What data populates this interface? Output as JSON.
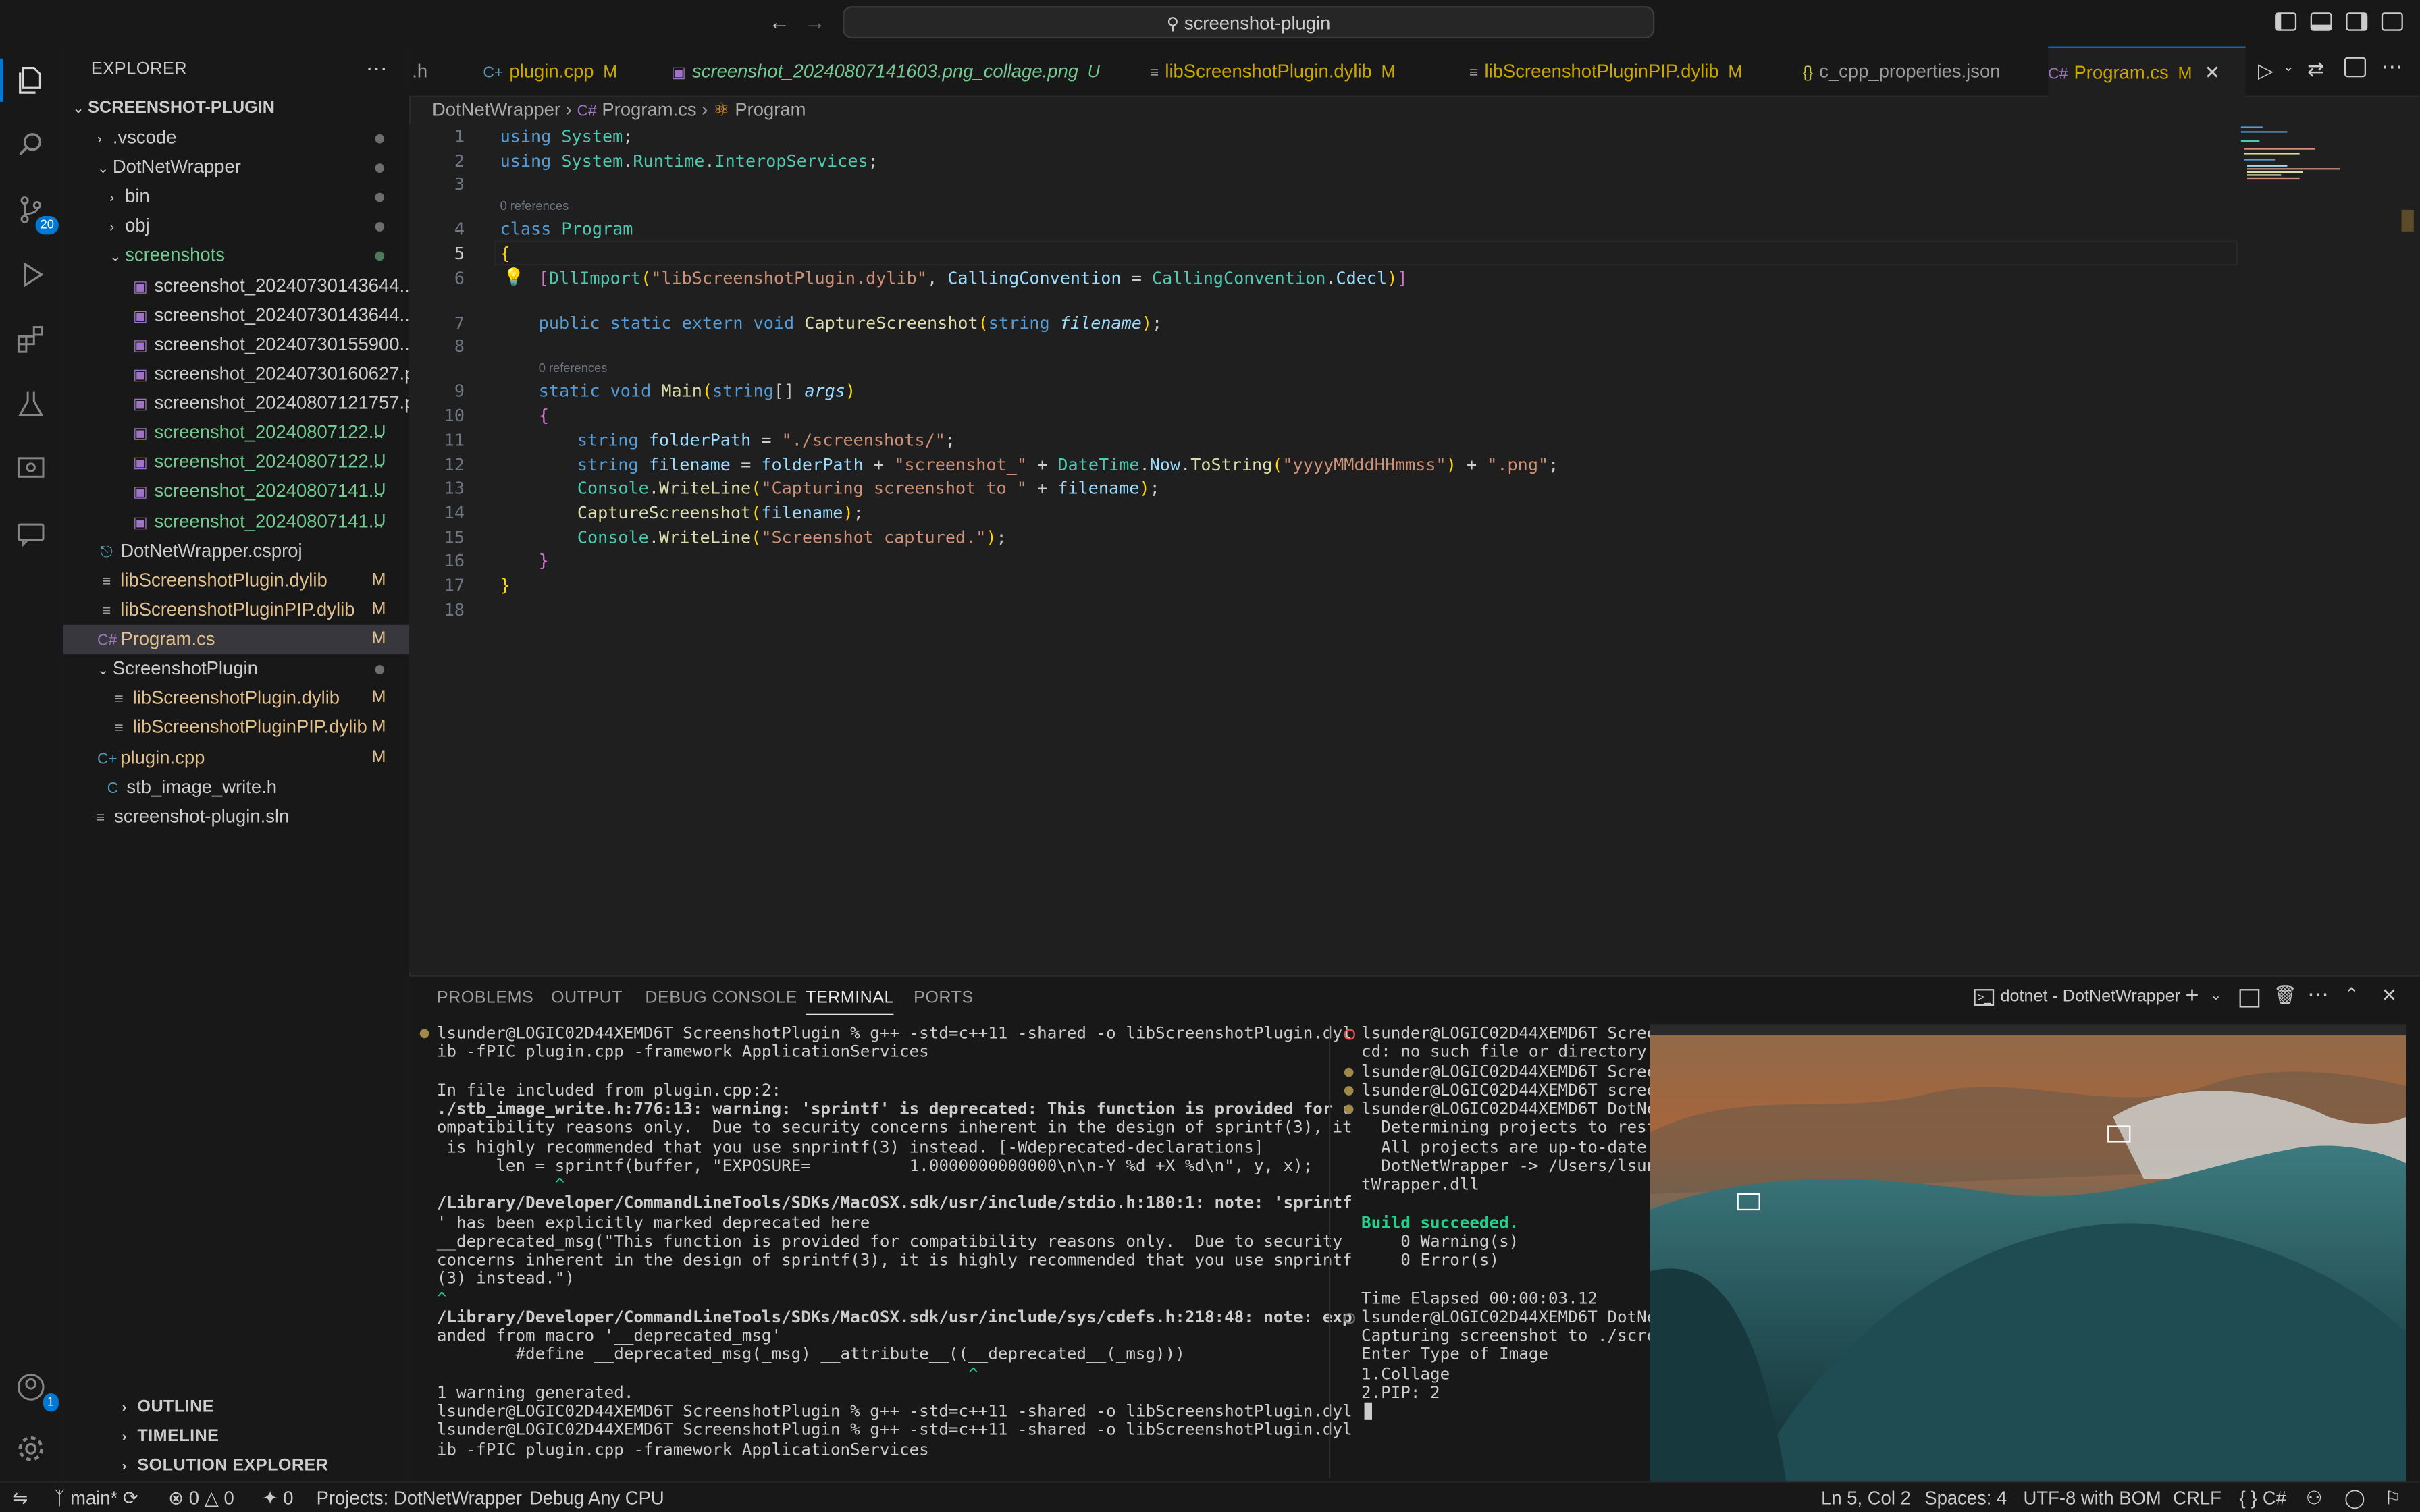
{
  "titlebar": {
    "search_text": "screenshot-plugin"
  },
  "activity": {
    "scm_badge": "20",
    "account_badge": "1"
  },
  "explorer": {
    "header": "EXPLORER",
    "root": "SCREENSHOT-PLUGIN",
    "items": [
      {
        "label": ".vscode",
        "git": ""
      },
      {
        "label": "DotNetWrapper",
        "git": ""
      },
      {
        "label": "bin",
        "git": ""
      },
      {
        "label": "obj",
        "git": ""
      },
      {
        "label": "screenshots",
        "git": ""
      },
      {
        "label": "screenshot_20240730143644....",
        "git": ""
      },
      {
        "label": "screenshot_20240730143644....",
        "git": ""
      },
      {
        "label": "screenshot_20240730155900....",
        "git": ""
      },
      {
        "label": "screenshot_20240730160627.p...",
        "git": ""
      },
      {
        "label": "screenshot_20240807121757.p...",
        "git": ""
      },
      {
        "label": "screenshot_20240807122...",
        "git": "U"
      },
      {
        "label": "screenshot_20240807122...",
        "git": "U"
      },
      {
        "label": "screenshot_20240807141...",
        "git": "U"
      },
      {
        "label": "screenshot_20240807141...",
        "git": "U"
      },
      {
        "label": "DotNetWrapper.csproj",
        "git": ""
      },
      {
        "label": "libScreenshotPlugin.dylib",
        "git": "M"
      },
      {
        "label": "libScreenshotPluginPIP.dylib",
        "git": "M"
      },
      {
        "label": "Program.cs",
        "git": "M"
      },
      {
        "label": "ScreenshotPlugin",
        "git": ""
      },
      {
        "label": "libScreenshotPlugin.dylib",
        "git": "M"
      },
      {
        "label": "libScreenshotPluginPIP.dylib",
        "git": "M"
      },
      {
        "label": "plugin.cpp",
        "git": "M"
      },
      {
        "label": "stb_image_write.h",
        "git": ""
      },
      {
        "label": "screenshot-plugin.sln",
        "git": ""
      }
    ],
    "sections": [
      "OUTLINE",
      "TIMELINE",
      "SOLUTION EXPLORER"
    ]
  },
  "tabs": [
    {
      "label": ".h",
      "mark": ""
    },
    {
      "label": "plugin.cpp",
      "mark": "M"
    },
    {
      "label": "screenshot_20240807141603.png_collage.png",
      "mark": "U"
    },
    {
      "label": "libScreenshotPlugin.dylib",
      "mark": "M"
    },
    {
      "label": "libScreenshotPluginPIP.dylib",
      "mark": "M"
    },
    {
      "label": "c_cpp_properties.json",
      "mark": ""
    },
    {
      "label": "Program.cs",
      "mark": "M"
    }
  ],
  "breadcrumb": [
    "DotNetWrapper",
    "Program.cs",
    "Program"
  ],
  "editor": {
    "line_numbers": [
      "1",
      "2",
      "3",
      "4",
      "5",
      "6",
      "7",
      "8",
      "9",
      "10",
      "11",
      "12",
      "13",
      "14",
      "15",
      "16",
      "17",
      "18"
    ],
    "lens_1": "0 references",
    "lens_2": "0 references",
    "code": {
      "l1a": "using",
      "l1b": "System",
      "l2a": "using",
      "l2b": "System",
      "l2c": "Runtime",
      "l2d": "InteropServices",
      "l4a": "class",
      "l4b": "Program",
      "l6a": "DllImport",
      "l6b": "\"libScreenshotPlugin.dylib\"",
      "l6c": "CallingConvention",
      "l6d": "CallingConvention",
      "l6e": "Cdecl",
      "l7a": "public static extern void",
      "l7b": "CaptureScreenshot",
      "l7c": "string",
      "l7d": "filename",
      "l9a": "static void",
      "l9b": "Main",
      "l9c": "string",
      "l9d": "args",
      "l11a": "string",
      "l11b": "folderPath",
      "l11c": "\"./screenshots/\"",
      "l12a": "string",
      "l12b": "filename",
      "l12c": "folderPath",
      "l12d": "\"screenshot_\"",
      "l12e": "DateTime",
      "l12f": "Now",
      "l12g": "ToString",
      "l12h": "\"yyyyMMddHHmmss\"",
      "l12i": "\".png\"",
      "l13a": "Console",
      "l13b": "WriteLine",
      "l13c": "\"Capturing screenshot to \"",
      "l13d": "filename",
      "l14a": "CaptureScreenshot",
      "l14b": "filename",
      "l15a": "Console",
      "l15b": "WriteLine",
      "l15c": "\"Screenshot captured.\""
    }
  },
  "panel": {
    "tabs": [
      "PROBLEMS",
      "OUTPUT",
      "DEBUG CONSOLE",
      "TERMINAL",
      "PORTS"
    ],
    "terminal_name": "dotnet - DotNetWrapper",
    "left_lines": [
      "lsunder@LOGIC02D44XEMD6T ScreenshotPlugin % g++ -std=c++11 -shared -o libScreenshotPlugin.dyl",
      "ib -fPIC plugin.cpp -framework ApplicationServices",
      "",
      "In file included from plugin.cpp:2:",
      "./stb_image_write.h:776:13: warning: 'sprintf' is deprecated: This function is provided for c",
      "ompatibility reasons only.  Due to security concerns inherent in the design of sprintf(3), it",
      " is highly recommended that you use snprintf(3) instead. [-Wdeprecated-declarations]",
      "      len = sprintf(buffer, \"EXPOSURE=          1.0000000000000\\n\\n-Y %d +X %d\\n\", y, x);",
      "            ^",
      "/Library/Developer/CommandLineTools/SDKs/MacOSX.sdk/usr/include/stdio.h:180:1: note: 'sprintf",
      "' has been explicitly marked deprecated here",
      "__deprecated_msg(\"This function is provided for compatibility reasons only.  Due to security",
      "concerns inherent in the design of sprintf(3), it is highly recommended that you use snprintf",
      "(3) instead.\")",
      "^",
      "/Library/Developer/CommandLineTools/SDKs/MacOSX.sdk/usr/include/sys/cdefs.h:218:48: note: exp",
      "anded from macro '__deprecated_msg'",
      "        #define __deprecated_msg(_msg) __attribute__((__deprecated__(_msg)))",
      "                                                      ^",
      "1 warning generated.",
      "lsunder@LOGIC02D44XEMD6T ScreenshotPlugin % g++ -std=c++11 -shared -o libScreenshotPlugin.dyl",
      "lsunder@LOGIC02D44XEMD6T ScreenshotPlugin % g++ -std=c++11 -shared -o libScreenshotPlugin.dyl",
      "ib -fPIC plugin.cpp -framework ApplicationServices",
      ""
    ],
    "right_lines": [
      "lsunder@LOGIC02D44XEMD6T Screen",
      "cd: no such file or directory:",
      "lsunder@LOGIC02D44XEMD6T Screen",
      "lsunder@LOGIC02D44XEMD6T screen",
      "lsunder@LOGIC02D44XEMD6T DotNet",
      "  Determining projects to resto",
      "  All projects are up-to-date f",
      "  DotNetWrapper -> /Users/lsund",
      "tWrapper.dll",
      "",
      "Build succeeded.",
      "    0 Warning(s)",
      "    0 Error(s)",
      "",
      "Time Elapsed 00:00:03.12",
      "lsunder@LOGIC02D44XEMD6T DotNet",
      "Capturing screenshot to ./scree",
      "Enter Type of Image",
      "1.Collage",
      "2.PIP: 2",
      ""
    ]
  },
  "statusbar": {
    "branch": "main*",
    "errors": "0",
    "warnings": "0",
    "ports": "0",
    "projects": "Projects: DotNetWrapper",
    "debug": "Debug Any CPU",
    "position": "Ln 5, Col 2",
    "spaces": "Spaces: 4",
    "encoding": "UTF-8 with BOM",
    "eol": "CRLF",
    "language": "C#"
  }
}
